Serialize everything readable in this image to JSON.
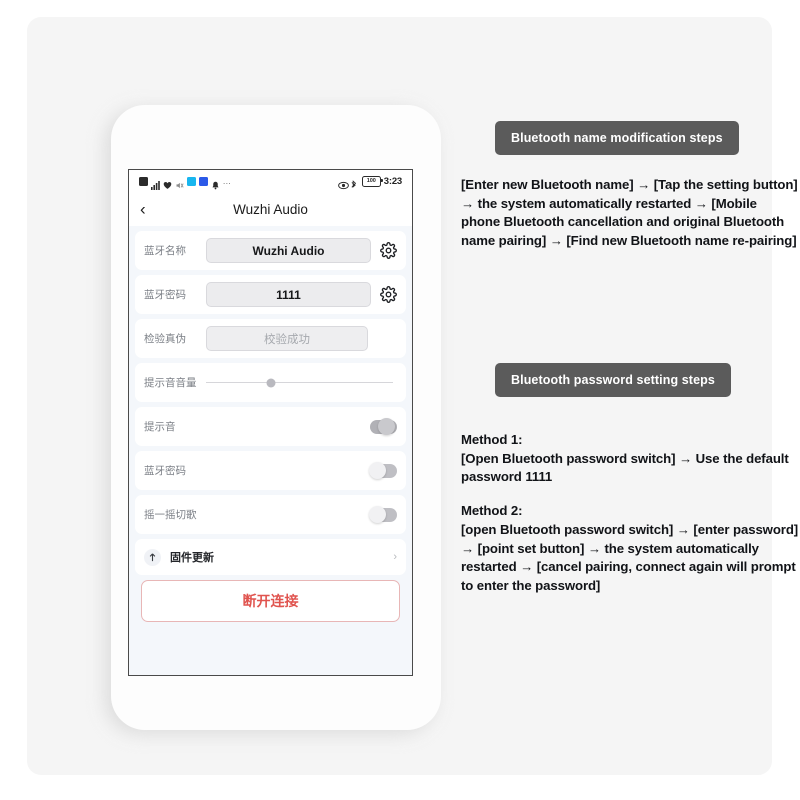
{
  "phone": {
    "status_bar": {
      "icons_left": [
        "message-icon",
        "signal-icon",
        "heart-icon",
        "mute-icon",
        "app-cyan-icon",
        "app-blue-icon",
        "bell-icon"
      ],
      "overflow": "...",
      "eye_icon": "eye-icon",
      "bluetooth_icon": "bluetooth-icon",
      "battery_level": "100",
      "time": "3:23"
    },
    "nav": {
      "back_icon": "chevron-left-icon",
      "title": "Wuzhi Audio"
    },
    "rows": [
      {
        "label": "蓝牙名称",
        "value": "Wuzhi Audio",
        "type": "input",
        "action_icon": "gear-icon"
      },
      {
        "label": "蓝牙密码",
        "value": "1111",
        "type": "input",
        "action_icon": "gear-icon"
      },
      {
        "label": "检验真伪",
        "value": "校验成功",
        "type": "button"
      },
      {
        "label": "提示音音量",
        "type": "slider",
        "slider_percent": 35
      },
      {
        "label": "提示音",
        "type": "switch",
        "switch_on": false
      },
      {
        "label": "蓝牙密码",
        "type": "switch",
        "switch_on": false
      },
      {
        "label": "摇一摇切歌",
        "type": "switch",
        "switch_on": false
      }
    ],
    "firmware": {
      "icon": "upload-arrow-icon",
      "label": "固件更新",
      "chevron": "chevron-right-icon"
    },
    "disconnect_label": "断开连接"
  },
  "instructions": {
    "badge1": "Bluetooth name modification steps",
    "text1": "[Enter new Bluetooth name] → [Tap the setting button] → the system automatically restarted → [Mobile phone Bluetooth cancellation and original Bluetooth name pairing] → [Find new Bluetooth name re-pairing]",
    "badge2": "Bluetooth password setting steps",
    "method1_title": "Method 1:",
    "method1_text": "[Open Bluetooth password switch] → Use the default password 1111",
    "method2_title": "Method 2:",
    "method2_text": "[open Bluetooth password switch] → [enter password] → [point set button] → the system automatically restarted → [cancel pairing, connect again will prompt to enter the password]"
  },
  "colors": {
    "badge_bg": "#5b5b5b",
    "disconnect_red": "#e0544f",
    "card_bg": "#f5f5f5"
  }
}
